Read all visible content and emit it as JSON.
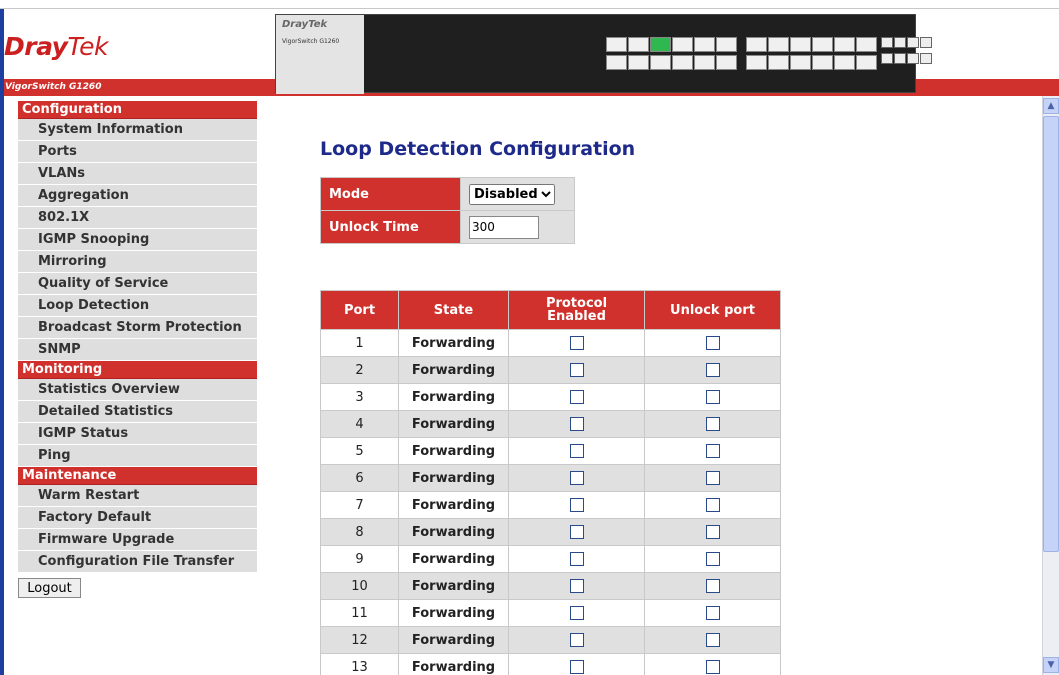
{
  "header": {
    "brand_bold": "Dray",
    "brand_tek": "Tek",
    "product_name": "VigorSwitch G1260",
    "switch_brand": "DrayTek",
    "switch_model": "VigorSwitch G1260"
  },
  "colors": {
    "brand_red": "#d0312d",
    "title_blue": "#1e2a8a",
    "row_gray": "#e0e0e0"
  },
  "sidebar": {
    "sections": [
      {
        "title": "Configuration",
        "items": [
          "System Information",
          "Ports",
          "VLANs",
          "Aggregation",
          "802.1X",
          "IGMP Snooping",
          "Mirroring",
          "Quality of Service",
          "Loop Detection",
          "Broadcast Storm Protection",
          "SNMP"
        ]
      },
      {
        "title": "Monitoring",
        "items": [
          "Statistics Overview",
          "Detailed Statistics",
          "IGMP Status",
          "Ping"
        ]
      },
      {
        "title": "Maintenance",
        "items": [
          "Warm Restart",
          "Factory Default",
          "Firmware Upgrade",
          "Configuration File Transfer"
        ]
      }
    ],
    "logout_label": "Logout"
  },
  "main": {
    "title": "Loop Detection Configuration",
    "config": {
      "mode_label": "Mode",
      "mode_value": "Disabled",
      "unlock_time_label": "Unlock Time",
      "unlock_time_value": "300"
    },
    "ports_table": {
      "headers": [
        "Port",
        "State",
        "Protocol Enabled",
        "Unlock port"
      ],
      "rows": [
        {
          "port": "1",
          "state": "Forwarding"
        },
        {
          "port": "2",
          "state": "Forwarding"
        },
        {
          "port": "3",
          "state": "Forwarding"
        },
        {
          "port": "4",
          "state": "Forwarding"
        },
        {
          "port": "5",
          "state": "Forwarding"
        },
        {
          "port": "6",
          "state": "Forwarding"
        },
        {
          "port": "7",
          "state": "Forwarding"
        },
        {
          "port": "8",
          "state": "Forwarding"
        },
        {
          "port": "9",
          "state": "Forwarding"
        },
        {
          "port": "10",
          "state": "Forwarding"
        },
        {
          "port": "11",
          "state": "Forwarding"
        },
        {
          "port": "12",
          "state": "Forwarding"
        },
        {
          "port": "13",
          "state": "Forwarding"
        }
      ]
    }
  }
}
